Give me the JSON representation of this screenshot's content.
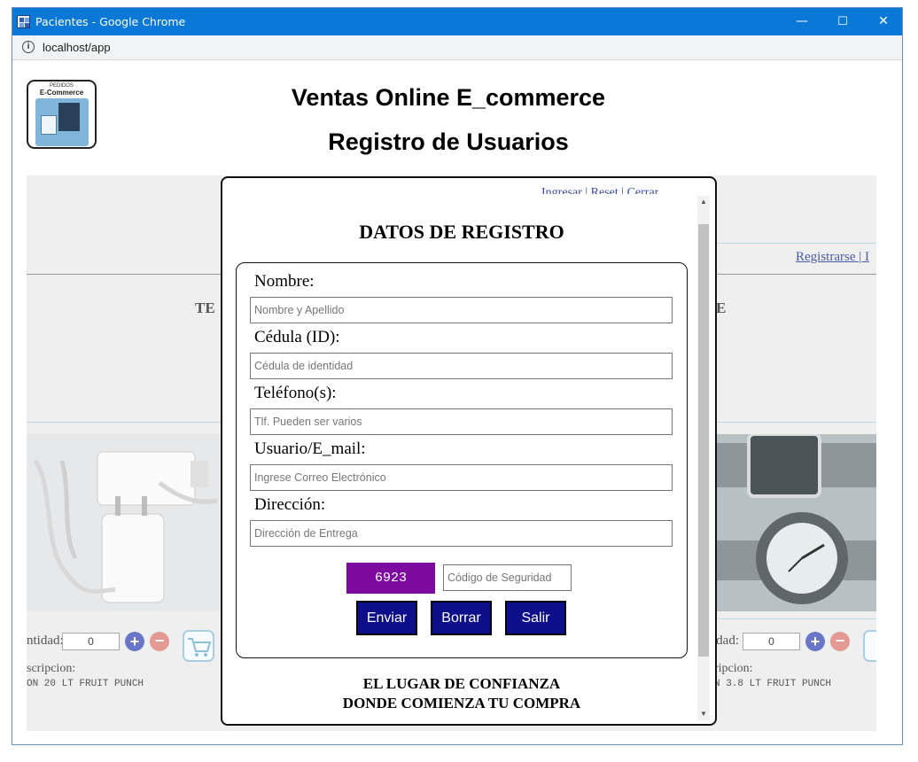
{
  "window": {
    "title": "Pacientes - Google Chrome",
    "minimize": "—",
    "maximize": "☐",
    "close": "✕"
  },
  "addressbar": {
    "info_icon": "i",
    "url": "localhost/app"
  },
  "header": {
    "logo_top": "PEDIDOS",
    "logo_brand": "E-Commerce",
    "title": "Ventas Online E_commerce",
    "subtitle": "Registro de Usuarios"
  },
  "background": {
    "nav_links": "Registrarse | I",
    "left_heading": "TE",
    "right_heading": "E",
    "left_product": {
      "qty_label": "ntidad:",
      "qty_value": "0",
      "desc_label": "scripcion:",
      "code": "ON 20 LT FRUIT PUNCH"
    },
    "right_product": {
      "qty_label": "idad:",
      "qty_value": "0",
      "desc_label": "ripcion:",
      "code": "N 3.8 LT FRUIT PUNCH"
    },
    "plus": "+",
    "minus": "−"
  },
  "modal": {
    "top_links": "Ingresar | Reset | Cerrar",
    "title": "DATOS DE REGISTRO",
    "fields": [
      {
        "label": "Nombre:",
        "placeholder": "Nombre y Apellido"
      },
      {
        "label": "Cédula (ID):",
        "placeholder": "Cédula de identidad"
      },
      {
        "label": "Teléfono(s):",
        "placeholder": "Tlf. Pueden ser varios"
      },
      {
        "label": "Usuario/E_mail:",
        "placeholder": "Ingrese Correo Electrónico"
      },
      {
        "label": "Dirección:",
        "placeholder": "Dirección de Entrega"
      }
    ],
    "captcha_code": "6923",
    "captcha_placeholder": "Código de Seguridad",
    "buttons": {
      "send": "Enviar",
      "clear": "Borrar",
      "exit": "Salir"
    },
    "tagline_1": "EL LUGAR DE CONFIANZA",
    "tagline_2": "DONDE COMIENZA TU COMPRA",
    "scroll_up": "▲",
    "scroll_down": "▼"
  }
}
